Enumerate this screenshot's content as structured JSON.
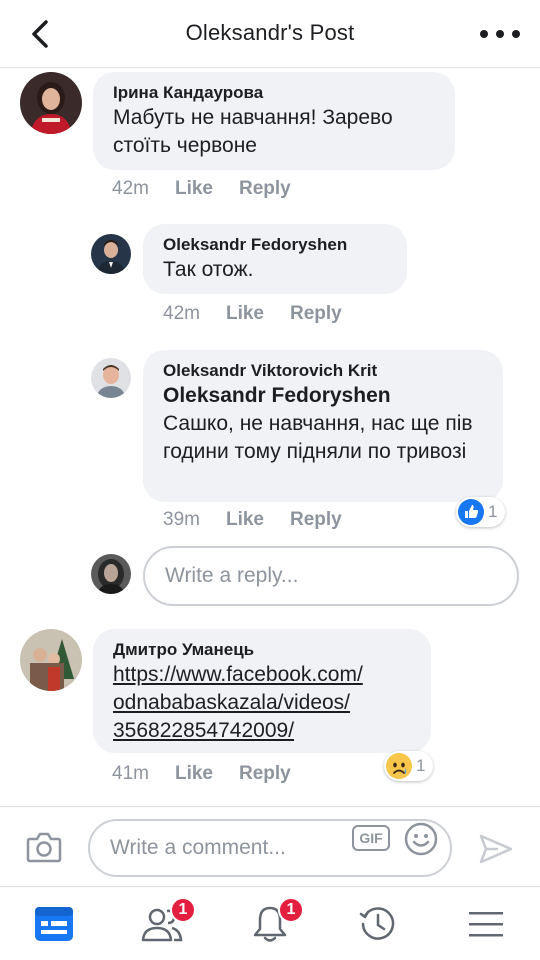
{
  "header": {
    "title": "Oleksandr's Post"
  },
  "comments": [
    {
      "author": "Ірина Кандаурова",
      "text": "Мабуть не навчання! Зарево стоїть червоне",
      "time": "42m",
      "like": "Like",
      "reply": "Reply"
    },
    {
      "author": "Oleksandr Fedoryshen",
      "text": "Так отож.",
      "time": "42m",
      "like": "Like",
      "reply": "Reply"
    },
    {
      "author": "Oleksandr Viktorovich Krit",
      "mention": "Oleksandr Fedoryshen",
      "text": "Сашко, не навчання, нас ще пів години тому підняли по тривозі",
      "time": "39m",
      "like": "Like",
      "reply": "Reply",
      "reaction_icon": "like-icon",
      "reaction_count": "1"
    },
    {
      "author": "Дмитро Уманець",
      "link_lines": [
        "https://www.facebook.com/",
        "odnababaskazala/videos/",
        "356822854742009/"
      ],
      "time": "41m",
      "like": "Like",
      "reply": "Reply",
      "reaction_icon": "sad-icon",
      "reaction_count": "1"
    }
  ],
  "reply_input": {
    "placeholder": "Write a reply..."
  },
  "composer": {
    "placeholder": "Write a comment...",
    "gif_label": "GIF"
  },
  "nav": {
    "friends_badge": "1",
    "notifications_badge": "1"
  },
  "colors": {
    "accent": "#1877f2",
    "badge": "#e41e3f",
    "bubble": "#f0f2f5",
    "muted": "#8d949e"
  }
}
